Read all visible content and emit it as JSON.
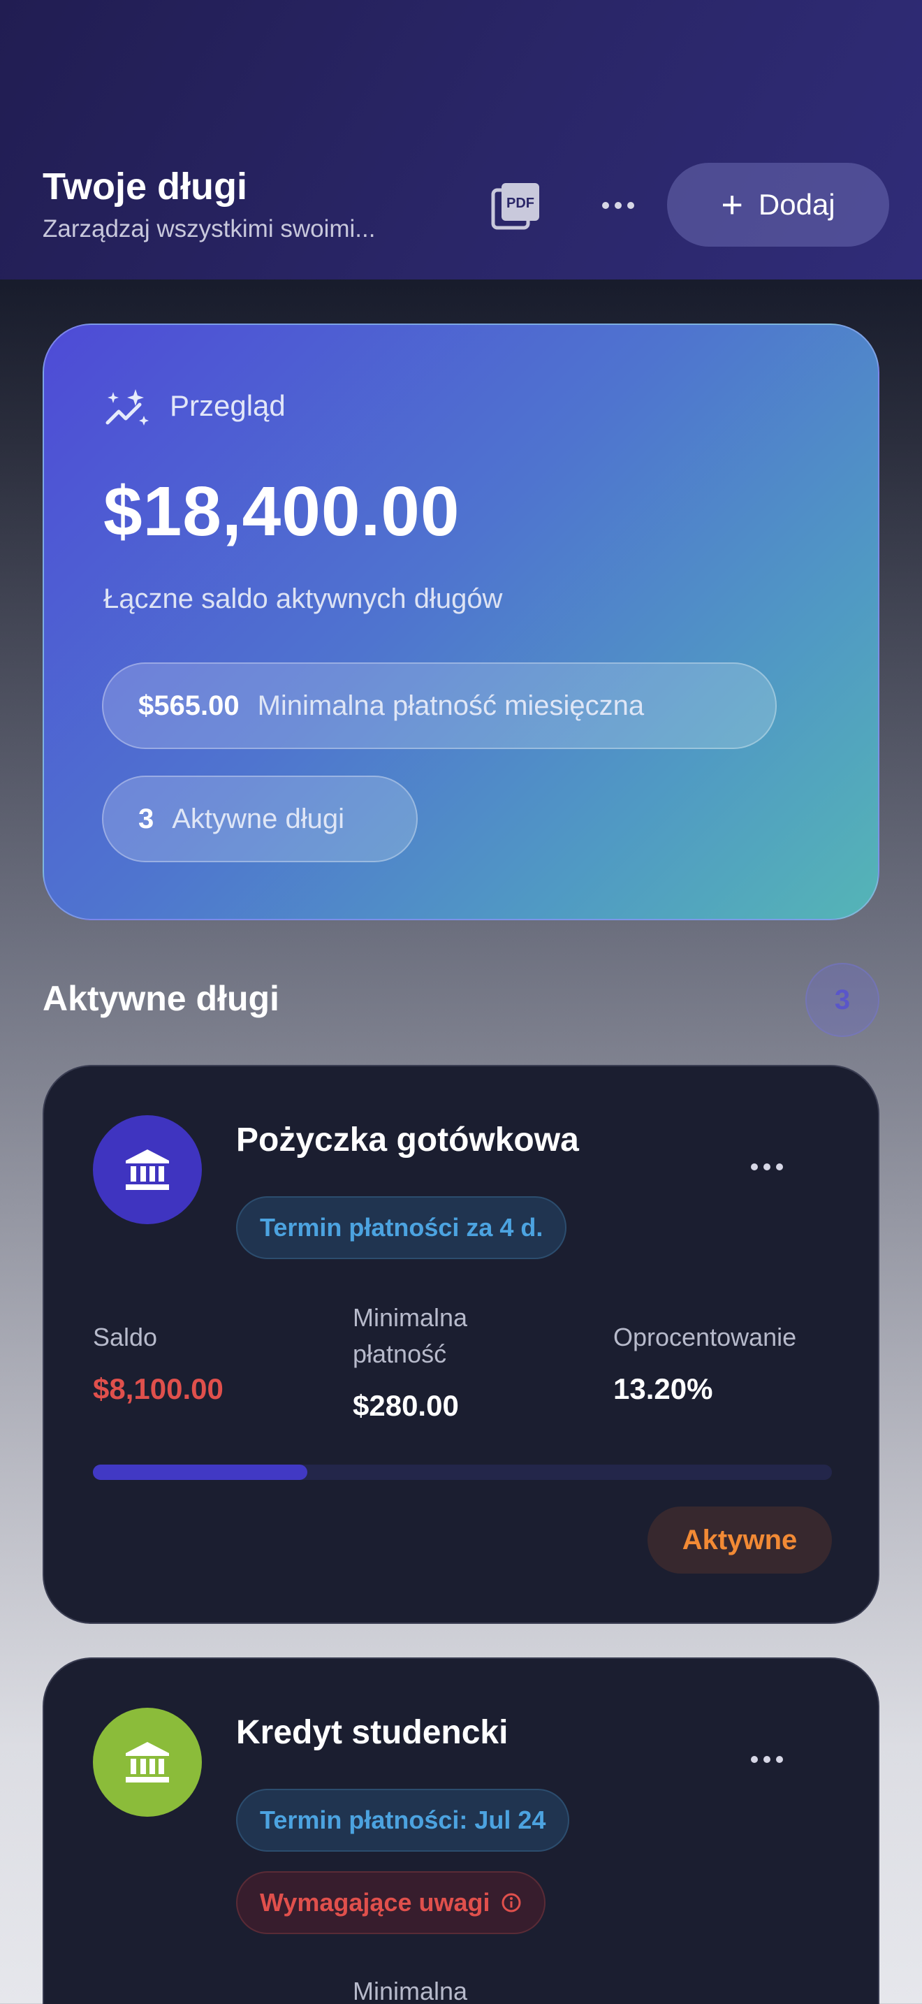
{
  "header": {
    "title": "Twoje długi",
    "subtitle": "Zarządzaj wszystkimi swoimi...",
    "pdf_icon": "pdf-icon",
    "more_icon": "more-horizontal-icon",
    "add_label": "Dodaj",
    "add_icon": "plus-icon"
  },
  "overview": {
    "icon": "sparkles-icon",
    "label": "Przegląd",
    "total": "$18,400.00",
    "total_desc": "Łączne saldo aktywnych długów",
    "min_payment_value": "$565.00",
    "min_payment_label": "Minimalna płatność miesięczna",
    "active_count": "3",
    "active_label": "Aktywne długi"
  },
  "active_section": {
    "title": "Aktywne długi",
    "count": "3"
  },
  "debts": [
    {
      "name": "Pożyczka gotówkowa",
      "icon": "bank-icon",
      "avatar_color": "#3f34c0",
      "due_badge": "Termin płatności za 4 d.",
      "balance_label": "Saldo",
      "balance": "$8,100.00",
      "min_label": "Minimalna płatność",
      "min_value": "$280.00",
      "rate_label": "Oprocentowanie",
      "rate_value": "13.20%",
      "progress": 0.29,
      "status": "Aktywne"
    },
    {
      "name": "Kredyt studencki",
      "icon": "bank-icon",
      "avatar_color": "#8bbc3a",
      "due_badge": "Termin płatności: Jul 24",
      "warning_badge": "Wymagające uwagi",
      "warning_icon": "info-icon",
      "min_label": "Minimalna"
    }
  ],
  "colors": {
    "accent": "#4139c4",
    "balance_red": "#e0504c",
    "status_orange": "#f28a35",
    "due_blue": "#4ca3e0"
  }
}
